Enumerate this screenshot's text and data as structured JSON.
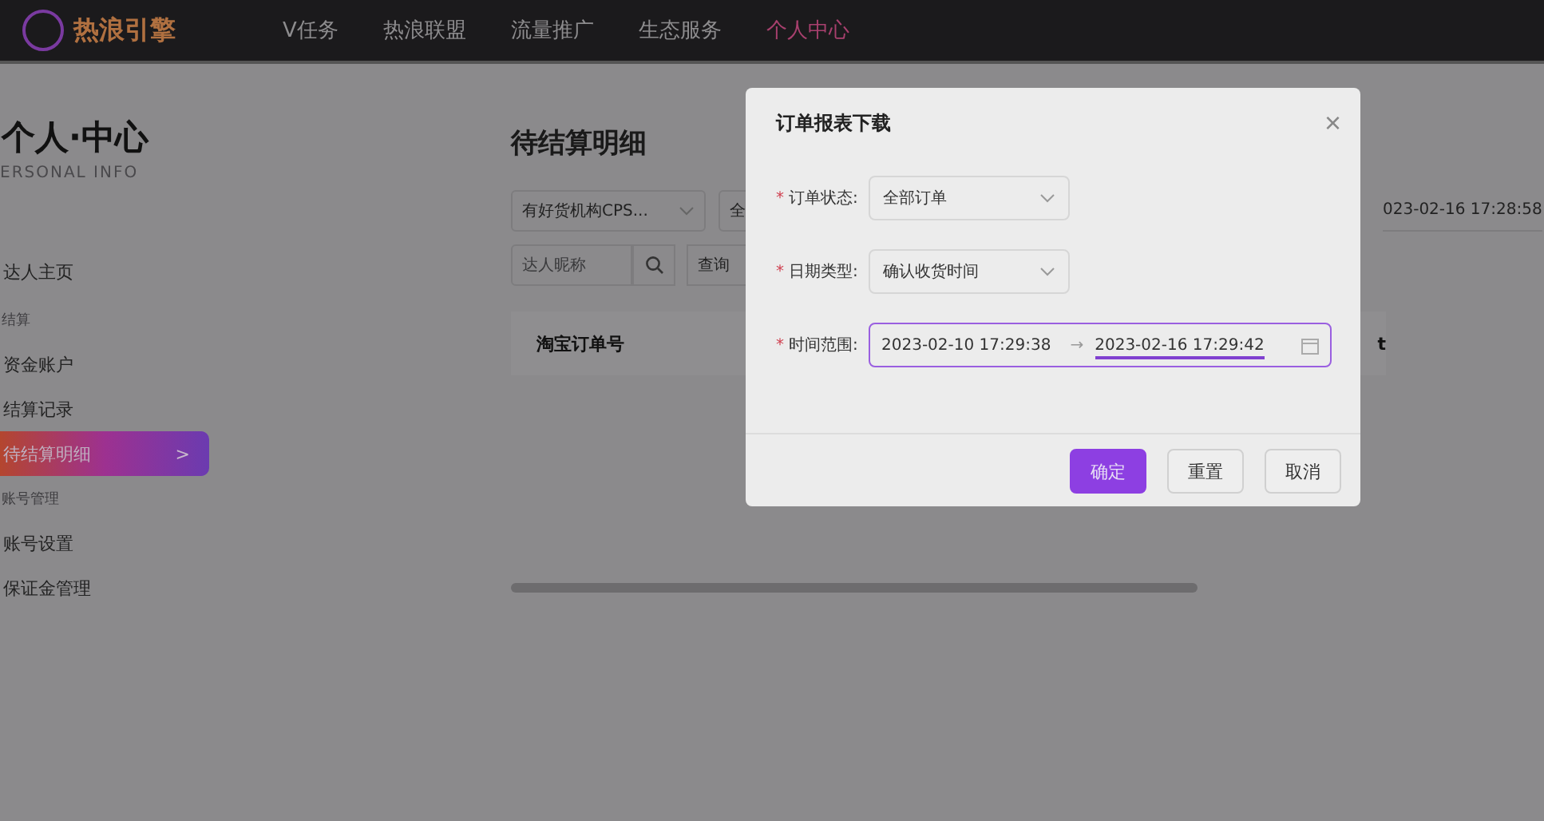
{
  "nav": {
    "logo": "热浪引擎",
    "items": [
      {
        "label": "V任务",
        "selected": false
      },
      {
        "label": "热浪联盟",
        "selected": false
      },
      {
        "label": "流量推广",
        "selected": false
      },
      {
        "label": "生态服务",
        "selected": false
      },
      {
        "label": "个人中心",
        "selected": true
      }
    ]
  },
  "sidebar": {
    "title": "个人·中心",
    "subtitle": "ERSONAL INFO",
    "items": [
      {
        "kind": "link",
        "label": "达人主页",
        "selected": false
      },
      {
        "kind": "section",
        "label": "结算"
      },
      {
        "kind": "link",
        "label": "资金账户",
        "selected": false
      },
      {
        "kind": "link",
        "label": "结算记录",
        "selected": false
      },
      {
        "kind": "link",
        "label": "待结算明细",
        "selected": true,
        "arrow": ">"
      },
      {
        "kind": "section",
        "label": "账号管理"
      },
      {
        "kind": "link",
        "label": "账号设置",
        "selected": false
      },
      {
        "kind": "link",
        "label": "保证金管理",
        "selected": false
      }
    ]
  },
  "main": {
    "title": "待结算明细",
    "filter_select": "有好货机构CPS...",
    "filter_select_2": "全",
    "date_end": "023-02-16 17:28:58",
    "search": {
      "placeholder": "达人昵称"
    },
    "query_button": "查询",
    "table": {
      "columns": [
        "淘宝订单号",
        "t"
      ]
    }
  },
  "dialog": {
    "title": "订单报表下载",
    "close": "×",
    "fields": [
      {
        "kind": "select",
        "label": "订单状态:",
        "required_mark": "*",
        "value": "全部订单"
      },
      {
        "kind": "select",
        "label": "日期类型:",
        "required_mark": "*",
        "value": "确认收货时间"
      },
      {
        "kind": "range",
        "label": "时间范围:",
        "required_mark": "*",
        "start": "2023-02-10 17:29:38",
        "separator": "→",
        "end": "2023-02-16 17:29:42"
      }
    ],
    "buttons": [
      {
        "label": "确定",
        "primary": true
      },
      {
        "label": "重置",
        "primary": false
      },
      {
        "label": "取消",
        "primary": false
      }
    ]
  }
}
